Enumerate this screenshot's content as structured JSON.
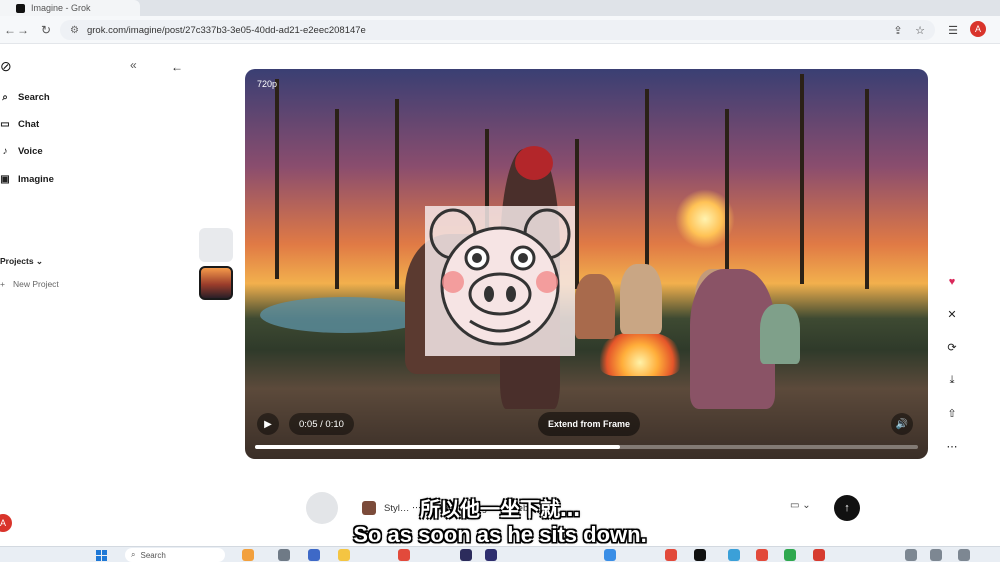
{
  "browser": {
    "tab_title": "Imagine - Grok",
    "url": "grok.com/imagine/post/27c337b3-3e05-40dd-ad21-e2eec208147e",
    "profile_initial": "A"
  },
  "sidebar": {
    "items": [
      {
        "label": "Search",
        "icon": "search-icon"
      },
      {
        "label": "Chat",
        "icon": "chat-icon"
      },
      {
        "label": "Voice",
        "icon": "voice-icon"
      },
      {
        "label": "Imagine",
        "icon": "image-icon"
      }
    ],
    "projects_label": "Projects",
    "new_project_label": "New Project",
    "user_initial": "A"
  },
  "video": {
    "resolution": "720p",
    "time": "0:05 / 0:10",
    "extend_label": "Extend from Frame",
    "progress": 0.55
  },
  "prompt": {
    "text": "Styl… ‧‧‧ reference images of Gebi …"
  },
  "subtitles": {
    "zh": "所以他一坐下就…",
    "en": "So as soon as he sits down."
  },
  "taskbar": {
    "search_label": "Search"
  },
  "colors": {
    "accent_red": "#d9342b",
    "heart": "#d9285a",
    "send_button": "#111111"
  }
}
